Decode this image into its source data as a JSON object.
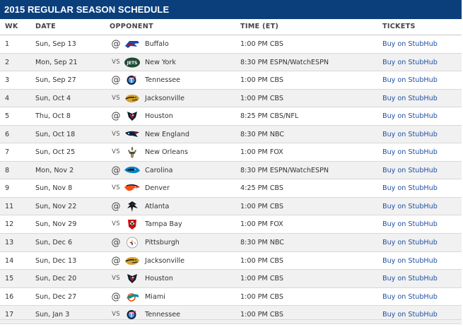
{
  "title": "2015 REGULAR SEASON SCHEDULE",
  "colors": {
    "title_bar": "#0b3f7c",
    "link": "#1f4fa3",
    "row_alt": "#f1f1f1"
  },
  "columns": {
    "wk": "WK",
    "date": "DATE",
    "opponent": "OPPONENT",
    "time": "TIME (ET)",
    "tickets": "TICKETS"
  },
  "games": [
    {
      "wk": "1",
      "date": "Sun, Sep 13",
      "ha": "@",
      "logo": "bills-logo-icon",
      "opponent": "Buffalo",
      "time": "1:00 PM CBS",
      "tickets": "Buy on StubHub"
    },
    {
      "wk": "2",
      "date": "Mon, Sep 21",
      "ha": "VS",
      "logo": "jets-logo-icon",
      "opponent": "New York",
      "time": "8:30 PM ESPN/WatchESPN",
      "tickets": "Buy on StubHub"
    },
    {
      "wk": "3",
      "date": "Sun, Sep 27",
      "ha": "@",
      "logo": "titans-logo-icon",
      "opponent": "Tennessee",
      "time": "1:00 PM CBS",
      "tickets": "Buy on StubHub"
    },
    {
      "wk": "4",
      "date": "Sun, Oct 4",
      "ha": "VS",
      "logo": "jaguars-logo-icon",
      "opponent": "Jacksonville",
      "time": "1:00 PM CBS",
      "tickets": "Buy on StubHub"
    },
    {
      "wk": "5",
      "date": "Thu, Oct 8",
      "ha": "@",
      "logo": "texans-logo-icon",
      "opponent": "Houston",
      "time": "8:25 PM CBS/NFL",
      "tickets": "Buy on StubHub"
    },
    {
      "wk": "6",
      "date": "Sun, Oct 18",
      "ha": "VS",
      "logo": "patriots-logo-icon",
      "opponent": "New England",
      "time": "8:30 PM NBC",
      "tickets": "Buy on StubHub"
    },
    {
      "wk": "7",
      "date": "Sun, Oct 25",
      "ha": "VS",
      "logo": "saints-logo-icon",
      "opponent": "New Orleans",
      "time": "1:00 PM FOX",
      "tickets": "Buy on StubHub"
    },
    {
      "wk": "8",
      "date": "Mon, Nov 2",
      "ha": "@",
      "logo": "panthers-logo-icon",
      "opponent": "Carolina",
      "time": "8:30 PM ESPN/WatchESPN",
      "tickets": "Buy on StubHub"
    },
    {
      "wk": "9",
      "date": "Sun, Nov 8",
      "ha": "VS",
      "logo": "broncos-logo-icon",
      "opponent": "Denver",
      "time": "4:25 PM CBS",
      "tickets": "Buy on StubHub"
    },
    {
      "wk": "11",
      "date": "Sun, Nov 22",
      "ha": "@",
      "logo": "falcons-logo-icon",
      "opponent": "Atlanta",
      "time": "1:00 PM CBS",
      "tickets": "Buy on StubHub"
    },
    {
      "wk": "12",
      "date": "Sun, Nov 29",
      "ha": "VS",
      "logo": "buccaneers-logo-icon",
      "opponent": "Tampa Bay",
      "time": "1:00 PM FOX",
      "tickets": "Buy on StubHub"
    },
    {
      "wk": "13",
      "date": "Sun, Dec 6",
      "ha": "@",
      "logo": "steelers-logo-icon",
      "opponent": "Pittsburgh",
      "time": "8:30 PM NBC",
      "tickets": "Buy on StubHub"
    },
    {
      "wk": "14",
      "date": "Sun, Dec 13",
      "ha": "@",
      "logo": "jaguars-logo-icon",
      "opponent": "Jacksonville",
      "time": "1:00 PM CBS",
      "tickets": "Buy on StubHub"
    },
    {
      "wk": "15",
      "date": "Sun, Dec 20",
      "ha": "VS",
      "logo": "texans-logo-icon",
      "opponent": "Houston",
      "time": "1:00 PM CBS",
      "tickets": "Buy on StubHub"
    },
    {
      "wk": "16",
      "date": "Sun, Dec 27",
      "ha": "@",
      "logo": "dolphins-logo-icon",
      "opponent": "Miami",
      "time": "1:00 PM CBS",
      "tickets": "Buy on StubHub"
    },
    {
      "wk": "17",
      "date": "Sun, Jan 3",
      "ha": "VS",
      "logo": "titans-logo-icon",
      "opponent": "Tennessee",
      "time": "1:00 PM CBS",
      "tickets": "Buy on StubHub"
    }
  ]
}
